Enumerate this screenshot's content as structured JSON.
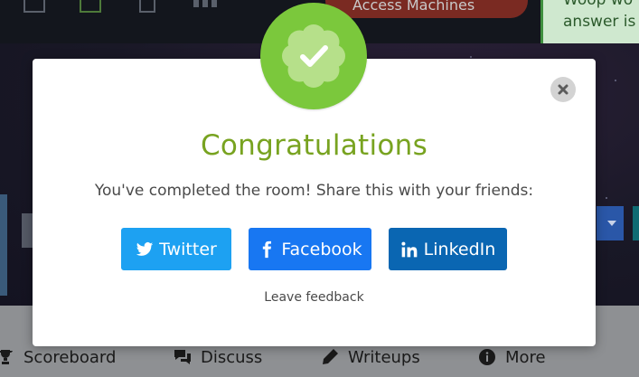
{
  "background": {
    "access_button_label": "Access Machines",
    "toast_text": "Woop wo answer is",
    "tabs": [
      {
        "label": "Scoreboard",
        "icon": "trophy-icon"
      },
      {
        "label": "Discuss",
        "icon": "discuss-icon"
      },
      {
        "label": "Writeups",
        "icon": "pencil-icon"
      },
      {
        "label": "More",
        "icon": "info-icon"
      }
    ]
  },
  "modal": {
    "badge_icon": "check-badge-icon",
    "title": "Congratulations",
    "subtitle": "You've completed the room! Share this with your friends:",
    "close_icon": "close-icon",
    "share_buttons": [
      {
        "label": "Twitter",
        "icon": "twitter-icon",
        "color": "#1da1f2"
      },
      {
        "label": "Facebook",
        "icon": "facebook-icon",
        "color": "#1877f2"
      },
      {
        "label": "LinkedIn",
        "icon": "linkedin-icon",
        "color": "#0a66b2"
      }
    ],
    "feedback_link": "Leave feedback"
  },
  "colors": {
    "accent_green": "#78a320",
    "badge_green": "#7bc83c"
  }
}
